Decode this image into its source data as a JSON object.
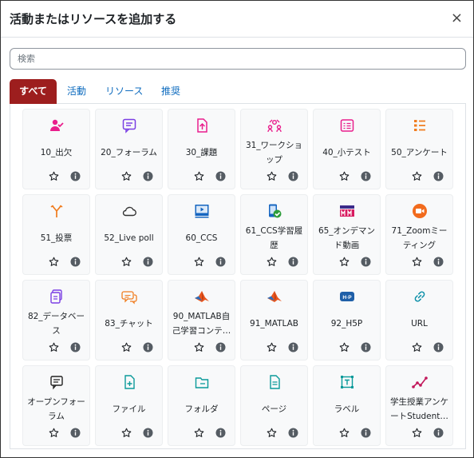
{
  "dialog": {
    "title": "活動またはリソースを追加する",
    "close": "×"
  },
  "search": {
    "placeholder": "検索"
  },
  "tabs": [
    {
      "label": "すべて",
      "active": true
    },
    {
      "label": "活動"
    },
    {
      "label": "リソース"
    },
    {
      "label": "推奨"
    }
  ],
  "items": [
    {
      "name": "10_出欠",
      "icon": "attendance-icon",
      "color": "#e91e8c"
    },
    {
      "name": "20_フォーラム",
      "icon": "forum-icon",
      "color": "#7b3fe4"
    },
    {
      "name": "30_課題",
      "icon": "assignment-icon",
      "color": "#e91e8c"
    },
    {
      "name": "31_ワークショップ",
      "icon": "workshop-icon",
      "color": "#e91e8c"
    },
    {
      "name": "40_小テスト",
      "icon": "quiz-icon",
      "color": "#e91e8c"
    },
    {
      "name": "50_アンケート",
      "icon": "feedback-icon",
      "color": "#f07c1e"
    },
    {
      "name": "51_投票",
      "icon": "choice-icon",
      "color": "#f07c1e"
    },
    {
      "name": "52_Live poll",
      "icon": "cloud-icon",
      "color": "#333333"
    },
    {
      "name": "60_CCS",
      "icon": "video-player-icon",
      "color": "#1565c0"
    },
    {
      "name": "61_CCS学習履歴",
      "icon": "phone-check-icon",
      "color": "#2e9d3a"
    },
    {
      "name": "65_オンデマンド動画",
      "icon": "mm-logo-icon",
      "color": "#d81b60"
    },
    {
      "name": "71_Zoomミーティング",
      "icon": "zoom-camera-icon",
      "color": "#f26b1d"
    },
    {
      "name": "82_データベース",
      "icon": "database-icon",
      "color": "#7b3fe4"
    },
    {
      "name": "83_チャット",
      "icon": "chat-icon",
      "color": "#f07c1e"
    },
    {
      "name": "90_MATLAB自己学習コンテ…",
      "icon": "matlab-logo-icon",
      "color": "#e8561e"
    },
    {
      "name": "91_MATLAB",
      "icon": "matlab-logo-icon",
      "color": "#e8561e"
    },
    {
      "name": "92_H5P",
      "icon": "h5p-icon",
      "color": "#1f5fa8"
    },
    {
      "name": "URL",
      "icon": "link-icon",
      "color": "#0a8fa8"
    },
    {
      "name": "オープンフォーラム",
      "icon": "open-forum-icon",
      "color": "#222222"
    },
    {
      "name": "ファイル",
      "icon": "file-icon",
      "color": "#0a9a9a"
    },
    {
      "name": "フォルダ",
      "icon": "folder-icon",
      "color": "#0a9a9a"
    },
    {
      "name": "ページ",
      "icon": "page-icon",
      "color": "#0a9a9a"
    },
    {
      "name": "ラベル",
      "icon": "label-icon",
      "color": "#0a9a9a"
    },
    {
      "name": "学生授業アンケートStudent…",
      "icon": "survey-chart-icon",
      "color": "#c2185b"
    }
  ]
}
